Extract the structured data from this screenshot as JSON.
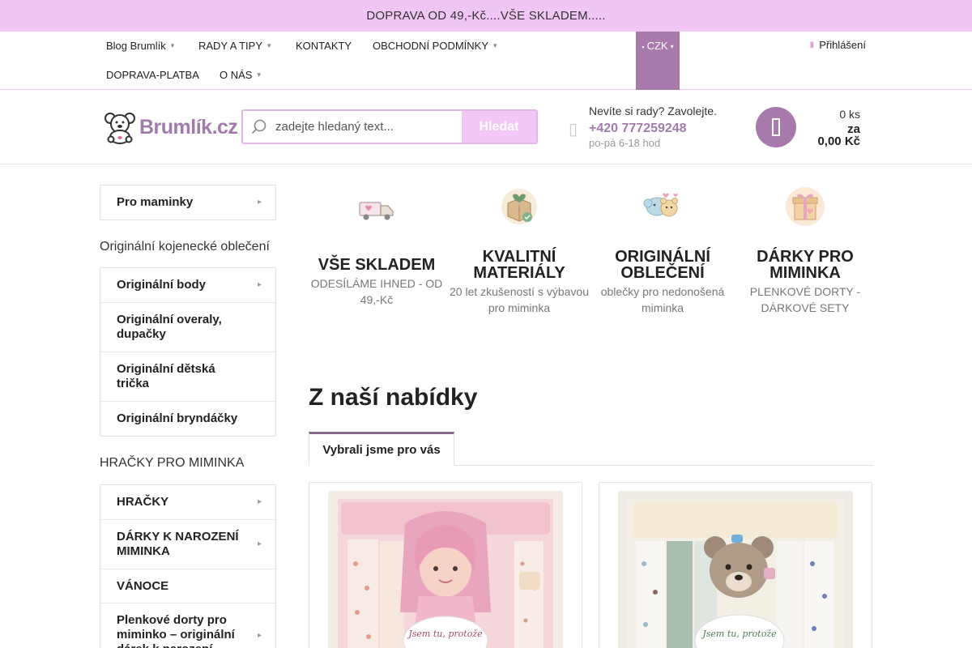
{
  "promo": {
    "text": "DOPRAVA OD 49,-Kč....VŠE SKLADEM....."
  },
  "topnav": {
    "links": [
      {
        "label": "Blog Brumlík"
      },
      {
        "label": "RADY A TIPY"
      },
      {
        "label": "KONTAKTY"
      },
      {
        "label": "OBCHODNÍ PODMÍNKY"
      },
      {
        "label": "DOPRAVA-PLATBA"
      },
      {
        "label": "O NÁS"
      }
    ],
    "currency": "CZK",
    "login": "Přihlášení"
  },
  "header": {
    "logo_text": "Brumlík.cz",
    "search": {
      "placeholder": "zadejte hledaný text...",
      "button": "Hledat"
    },
    "contact": {
      "question": "Nevíte si rady? Zavolejte.",
      "phone": "+420 777259248",
      "hours": "po-pá 6-18 hod"
    },
    "cart": {
      "count": "0 ks",
      "za": "za",
      "total": "0,00 Kč"
    }
  },
  "sidebar": {
    "top_category": "Pro maminky",
    "heading1": "Originální kojenecké oblečení",
    "group1": [
      "Originální body",
      "Originální overaly, dupačky",
      "Originální dětská trička",
      "Originální bryndáčky"
    ],
    "heading2": "HRAČKY PRO MIMINKA",
    "group2": [
      "HRAČKY",
      "DÁRKY K NAROZENÍ MIMINKA",
      "VÁNOCE",
      "Plenkové dorty pro miminko – originální dárek k narození"
    ]
  },
  "benefits": [
    {
      "title": "VŠE SKLADEM",
      "subtitle": "ODESÍLÁME IHNED - OD 49,-Kč",
      "icon": "delivery-truck-icon"
    },
    {
      "title": "KVALITNÍ MATERIÁLY",
      "subtitle": "20 let zkušeností s výbavou pro miminka",
      "icon": "heart-box-icon"
    },
    {
      "title": "ORIGINÁLNÍ OBLEČENÍ",
      "subtitle": "oblečky pro nedonošená miminka",
      "icon": "elephant-bear-icon"
    },
    {
      "title": "DÁRKY PRO MIMINKA",
      "subtitle": "PLENKOVÉ DORTY - DÁRKOVÉ SETY",
      "icon": "gift-box-icon"
    }
  ],
  "offer": {
    "title": "Z naší nabídky",
    "tab": "Vybrali jsme pro vás"
  },
  "colors": {
    "accent": "#a77aab",
    "promo_bg": "#f0c6f4",
    "search_btn": "#f4c8f6"
  }
}
